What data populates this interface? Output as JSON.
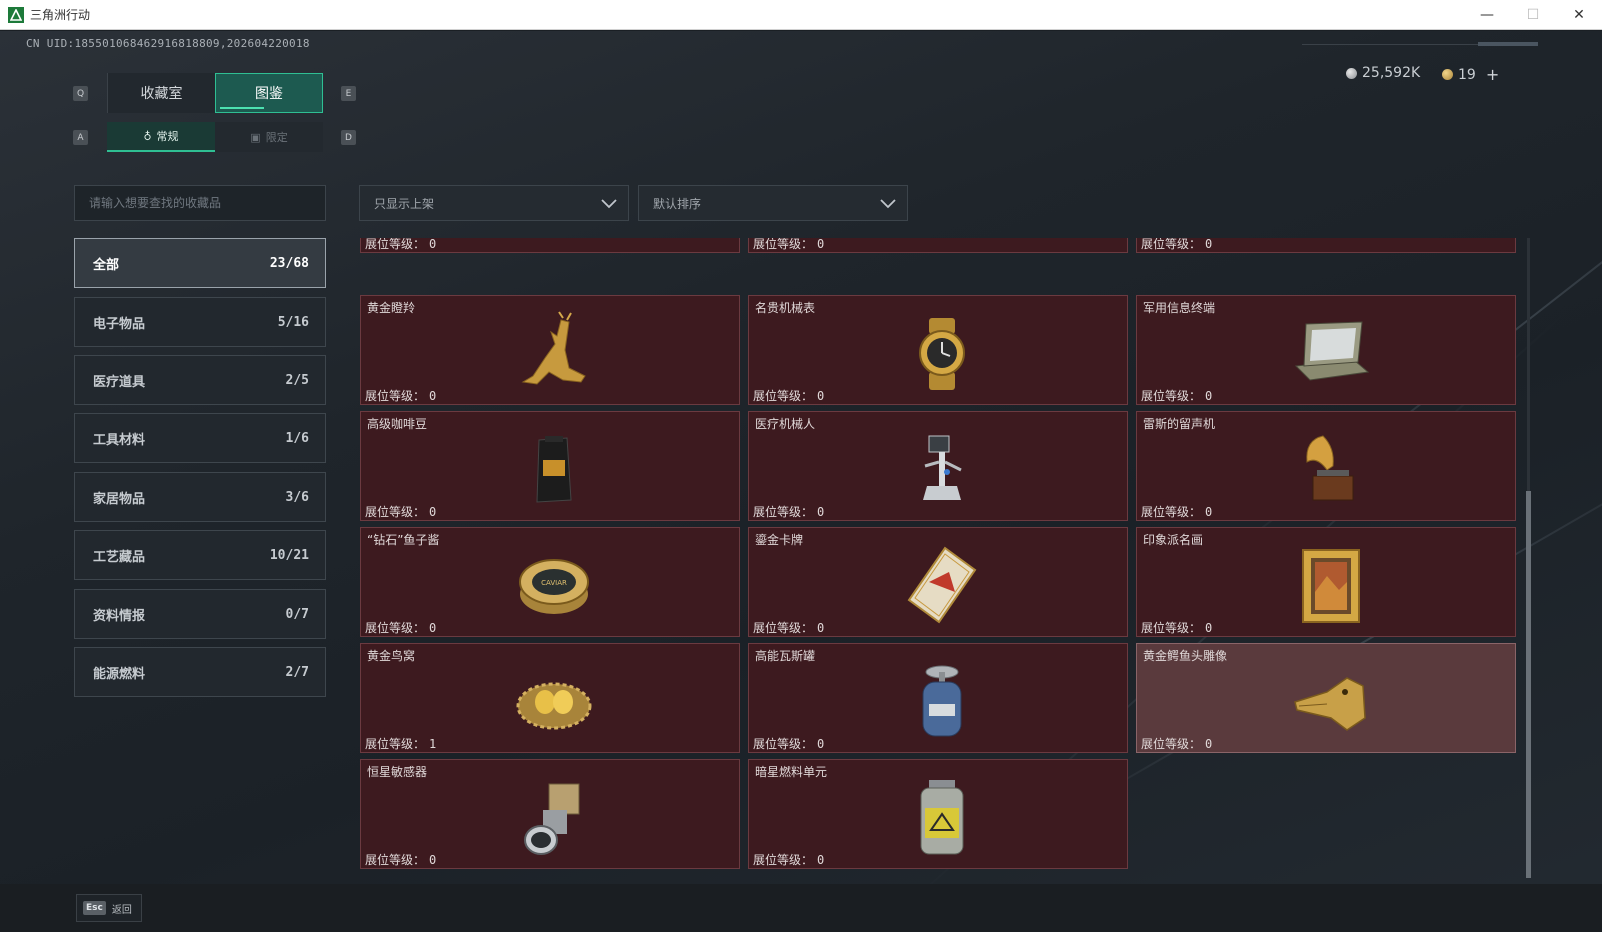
{
  "window": {
    "title": "三角洲行动",
    "minimize": "—",
    "maximize": "☐",
    "close": "✕"
  },
  "header": {
    "uid": "CN UID:185501068462916818809,202604220018",
    "currency_silver": "25,592K",
    "currency_gold": "19",
    "add": "+"
  },
  "keys": {
    "prev_tab": "Q",
    "next_tab": "E",
    "prev_sub": "A",
    "next_sub": "D"
  },
  "tabs": [
    {
      "label": "收藏室",
      "active": false
    },
    {
      "label": "图鉴",
      "active": true
    }
  ],
  "subtabs": [
    {
      "label": "常规",
      "icon": "bottle-icon",
      "active": true
    },
    {
      "label": "限定",
      "icon": "picture-icon",
      "active": false
    }
  ],
  "search": {
    "placeholder": "请输入想要查找的收藏品"
  },
  "filters": {
    "listing": "只显示上架",
    "sort": "默认排序"
  },
  "categories": [
    {
      "label": "全部",
      "count": "23/68",
      "active": true
    },
    {
      "label": "电子物品",
      "count": "5/16"
    },
    {
      "label": "医疗道具",
      "count": "2/5"
    },
    {
      "label": "工具材料",
      "count": "1/6"
    },
    {
      "label": "家居物品",
      "count": "3/6"
    },
    {
      "label": "工艺藏品",
      "count": "10/21"
    },
    {
      "label": "资料情报",
      "count": "0/7"
    },
    {
      "label": "能源燃料",
      "count": "2/7"
    }
  ],
  "level_label": "展位等级：",
  "partial_row": [
    {
      "level": "0"
    },
    {
      "level": "0"
    },
    {
      "level": "0"
    }
  ],
  "items": [
    {
      "name": "黄金瞪羚",
      "level": "0",
      "icon": "gazelle-icon"
    },
    {
      "name": "名贵机械表",
      "level": "0",
      "icon": "watch-icon"
    },
    {
      "name": "军用信息终端",
      "level": "0",
      "icon": "terminal-icon"
    },
    {
      "name": "高级咖啡豆",
      "level": "0",
      "icon": "coffee-bag-icon"
    },
    {
      "name": "医疗机械人",
      "level": "0",
      "icon": "medical-robot-icon"
    },
    {
      "name": "雷斯的留声机",
      "level": "0",
      "icon": "gramophone-icon"
    },
    {
      "name": "“钻石”鱼子酱",
      "level": "0",
      "icon": "caviar-tin-icon"
    },
    {
      "name": "鎏金卡牌",
      "level": "0",
      "icon": "gold-card-icon"
    },
    {
      "name": "印象派名画",
      "level": "0",
      "icon": "painting-icon"
    },
    {
      "name": "黄金鸟窝",
      "level": "1",
      "icon": "golden-nest-icon"
    },
    {
      "name": "高能瓦斯罐",
      "level": "0",
      "icon": "gas-tank-icon"
    },
    {
      "name": "黄金鳄鱼头雕像",
      "level": "0",
      "icon": "crocodile-head-icon",
      "highlight": true
    },
    {
      "name": "恒星敏感器",
      "level": "0",
      "icon": "star-sensor-icon"
    },
    {
      "name": "暗星燃料单元",
      "level": "0",
      "icon": "fuel-cell-icon"
    }
  ],
  "caviar_label": "CAVIAR",
  "footer": {
    "esc_key": "Esc",
    "esc_label": "返回"
  },
  "colors": {
    "card_bg": "#3d1a1f",
    "card_border": "#6b3a40",
    "accent_green": "#2fbf93",
    "highlight_card": "#5a3a3d"
  }
}
